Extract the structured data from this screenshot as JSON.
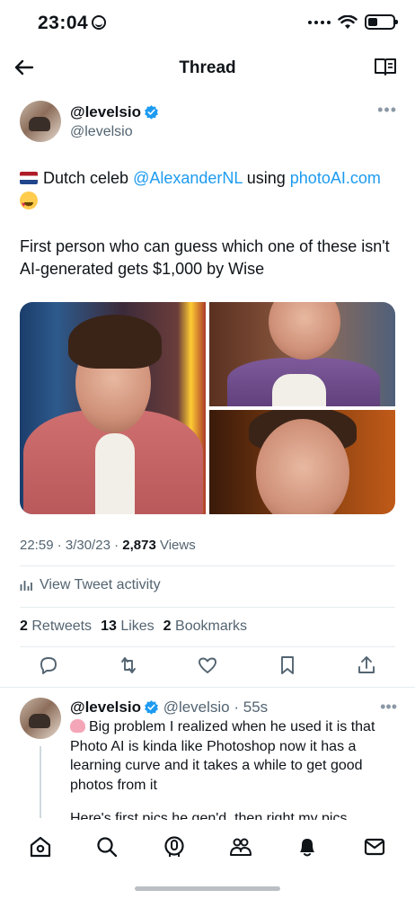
{
  "status_bar": {
    "time": "23:04"
  },
  "header": {
    "title": "Thread"
  },
  "tweet": {
    "author_name": "@levelsio",
    "author_handle": "@levelsio",
    "text_part1": "Dutch celeb ",
    "mention": "@AlexanderNL",
    "text_part2": " using ",
    "link": "photoAI.com",
    "paragraph2": "First person who can guess which one of these isn't AI-generated gets $1,000 by Wise",
    "time": "22:59 · 3/30/23 · ",
    "views_count": "2,873",
    "views_label": " Views",
    "activity_label": "View Tweet activity",
    "retweets_count": "2",
    "retweets_label": "Retweets",
    "likes_count": "13",
    "likes_label": "Likes",
    "bookmarks_count": "2",
    "bookmarks_label": "Bookmarks"
  },
  "reply": {
    "author_name": "@levelsio",
    "handle_time": "@levelsio · 55s",
    "text": "Big problem I realized when he used it is that Photo AI is kinda like Photoshop now it has a learning curve and it takes a while to get good photos from it",
    "cut_text": "Here's first pics he gen'd, then right my pics"
  },
  "tabbar": {
    "items": [
      "home-icon",
      "search-icon",
      "spaces-icon",
      "communities-icon",
      "notifications-icon",
      "messages-icon"
    ]
  },
  "colors": {
    "accent": "#1d9bf0",
    "text": "#0f1419",
    "secondary": "#536471"
  }
}
